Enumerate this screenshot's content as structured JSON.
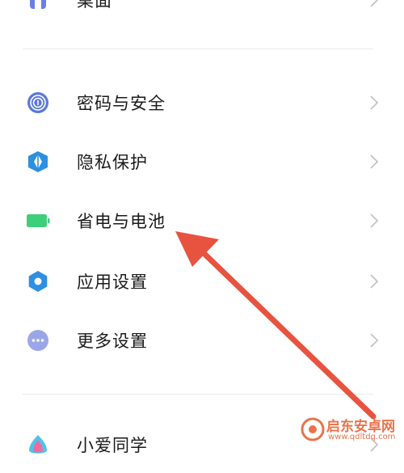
{
  "settings_list": {
    "items": [
      {
        "label": "桌面",
        "icon": "desktop-icon"
      },
      {
        "label": "密码与安全",
        "icon": "fingerprint-icon"
      },
      {
        "label": "隐私保护",
        "icon": "privacy-shield-icon"
      },
      {
        "label": "省电与电池",
        "icon": "battery-icon"
      },
      {
        "label": "应用设置",
        "icon": "gear-icon"
      },
      {
        "label": "更多设置",
        "icon": "more-dots-icon"
      },
      {
        "label": "小爱同学",
        "icon": "xiaoai-icon"
      }
    ]
  },
  "watermark": {
    "title": "启东安卓网",
    "url": "www.qdltdq.com"
  },
  "colors": {
    "arrow": "#e8533f",
    "fingerprint": "#5a78d8",
    "shield": "#2c8fe0",
    "battery": "#3ecf7a",
    "gear": "#2f8fe0",
    "more": "#9aa6e8",
    "watermark": "#e8734a"
  }
}
